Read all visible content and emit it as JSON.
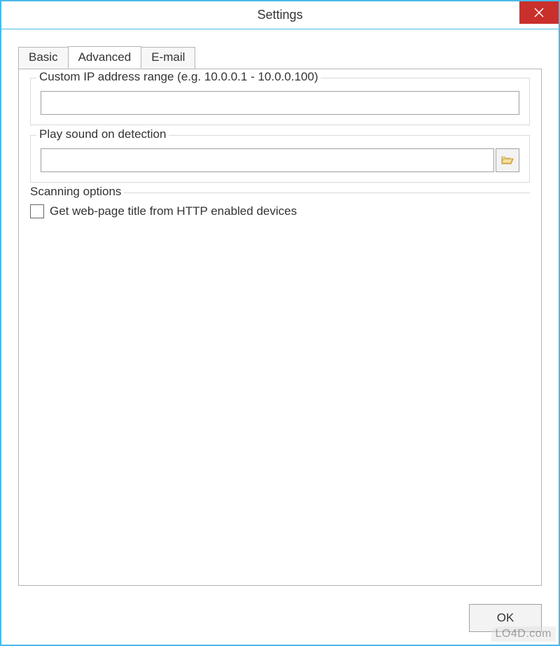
{
  "window": {
    "title": "Settings"
  },
  "tabs": {
    "basic": "Basic",
    "advanced": "Advanced",
    "email": "E-mail",
    "active": "advanced"
  },
  "groups": {
    "ip_range": {
      "title": "Custom IP address range (e.g. 10.0.0.1 - 10.0.0.100)",
      "value": ""
    },
    "sound": {
      "title": "Play sound on detection",
      "value": ""
    },
    "scanning": {
      "title": "Scanning options",
      "checkbox_label": "Get web-page title from HTTP enabled devices",
      "checkbox_checked": false
    }
  },
  "buttons": {
    "ok": "OK"
  },
  "watermark": "LO4D.com"
}
